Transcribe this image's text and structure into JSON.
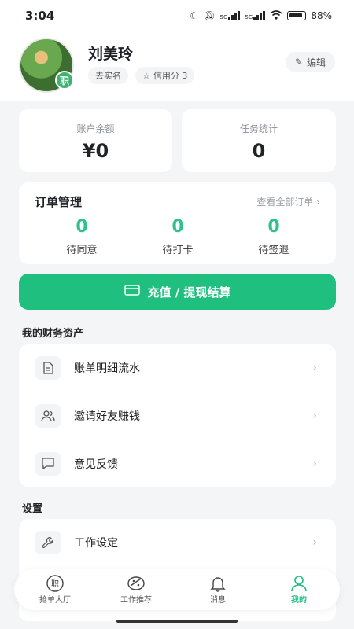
{
  "status": {
    "time": "3:04",
    "signal1": "5G",
    "signal2": "5G",
    "battery": "88%"
  },
  "profile": {
    "name": "刘美玲",
    "badge": "职",
    "tag_realname": "去实名",
    "tag_credit": "信用分 3",
    "edit_label": "编辑"
  },
  "stats": {
    "balance_label": "账户余额",
    "balance_value": "¥0",
    "tasks_label": "任务统计",
    "tasks_value": "0"
  },
  "orders": {
    "title": "订单管理",
    "view_all": "查看全部订单",
    "items": [
      {
        "count": "0",
        "label": "待同意"
      },
      {
        "count": "0",
        "label": "待打卡"
      },
      {
        "count": "0",
        "label": "待签退"
      }
    ]
  },
  "recharge_label": "充值 / 提现结算",
  "finance": {
    "title": "我的财务资产",
    "items": [
      {
        "label": "账单明细流水",
        "icon": "document-icon"
      },
      {
        "label": "邀请好友赚钱",
        "icon": "users-icon"
      },
      {
        "label": "意见反馈",
        "icon": "message-icon"
      }
    ]
  },
  "settings": {
    "title": "设置",
    "items": [
      {
        "label": "工作设定",
        "icon": "wrench-icon"
      }
    ]
  },
  "tabs": [
    {
      "label": "抢单大厅",
      "icon": "job-icon"
    },
    {
      "label": "工作推荐",
      "icon": "recommend-icon"
    },
    {
      "label": "消息",
      "icon": "bell-icon"
    },
    {
      "label": "我的",
      "icon": "user-icon"
    }
  ],
  "colors": {
    "accent": "#1fbf7f",
    "count": "#2ec28a",
    "background": "#f3f5f7"
  }
}
